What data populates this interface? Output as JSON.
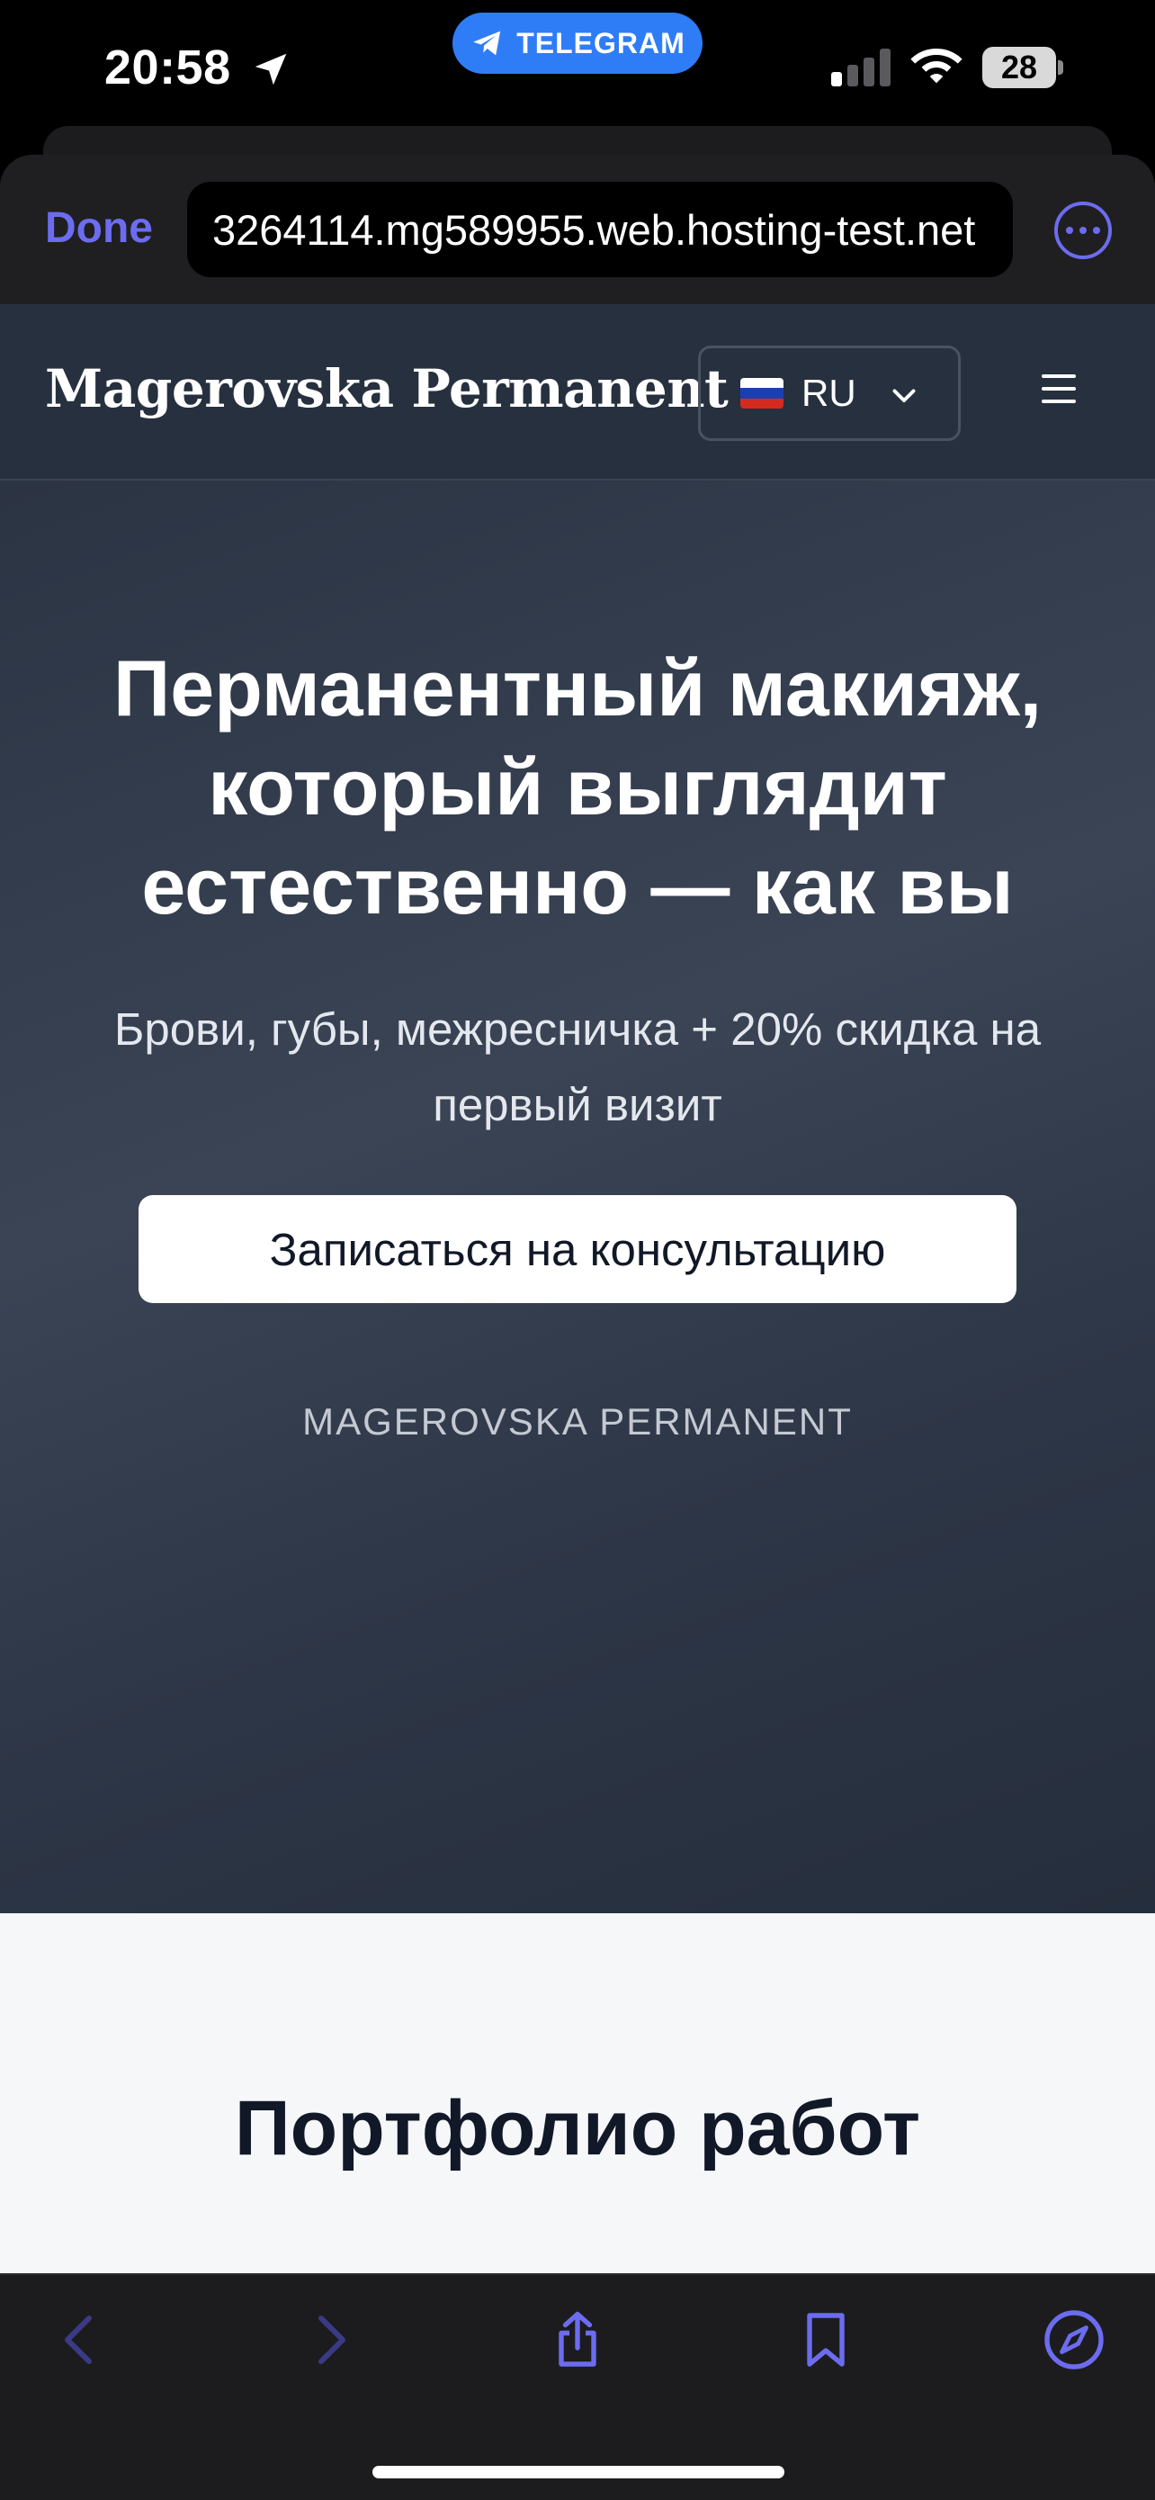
{
  "status_bar": {
    "time": "20:58",
    "pill_label": "TELEGRAM",
    "battery": "28",
    "icons": [
      "location-arrow-icon",
      "telegram-icon",
      "cellular-signal-icon",
      "wifi-icon",
      "battery-icon"
    ]
  },
  "browser": {
    "done_label": "Done",
    "url": "3264114.mg589955.web.hosting-test.net",
    "more_icon": "ellipsis-circle-icon",
    "accent": "#6c6cf0"
  },
  "site": {
    "brand": "Magerovska Permanent",
    "language": {
      "code": "RU",
      "flag_icon": "russian-flag-icon"
    },
    "menu_icon": "hamburger-menu-icon",
    "hero": {
      "title": "Перманентный макияж, который выглядит естественно — как вы",
      "subtitle": "Брови, губы, межресничка + 20% скидка на первый визит",
      "cta_label": "Записаться на консультацию",
      "watermark": "MAGEROVSKA PERMANENT"
    },
    "portfolio_title": "Портфолио работ"
  },
  "toolbar": {
    "icons": [
      "back-chevron-icon",
      "forward-chevron-icon",
      "share-icon",
      "bookmark-icon",
      "compass-icon"
    ]
  }
}
